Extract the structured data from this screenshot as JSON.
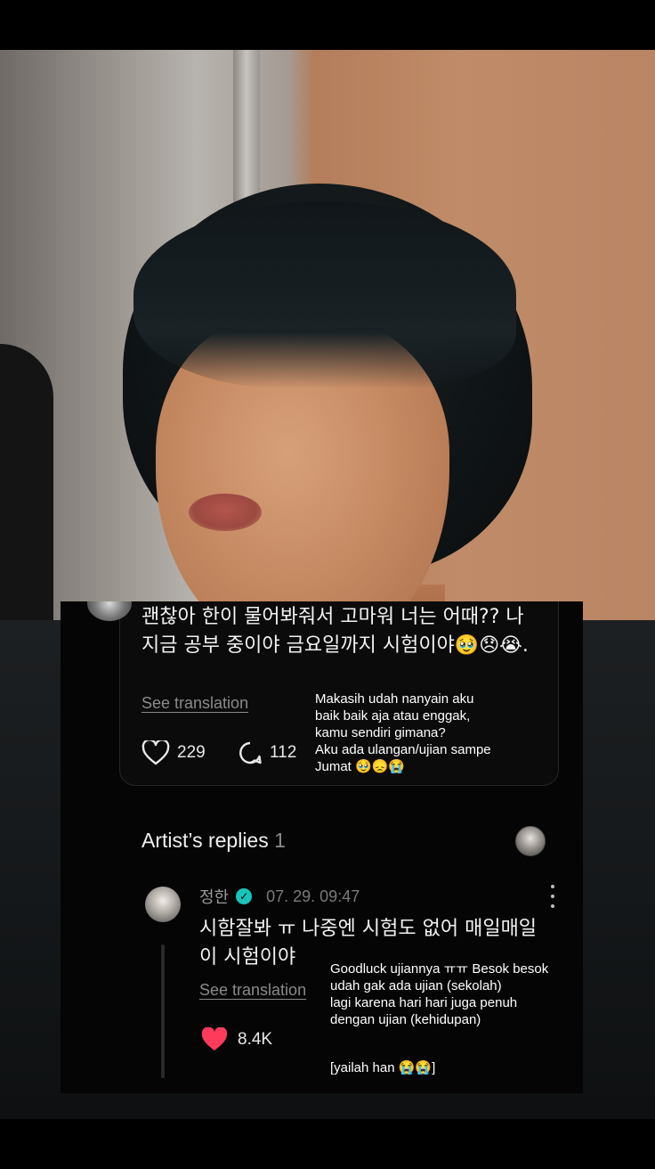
{
  "post": {
    "text": "괜찮아 한이 물어봐줘서 고마워 너는 어때?? 나 지금 공부 중이야 금요일까지 시험이야🥹😞😭.",
    "see_translation": "See translation",
    "likes": "229",
    "comments": "112",
    "caption_lines": [
      "Makasih udah nanyain aku",
      "baik baik aja atau enggak,",
      "kamu sendiri gimana?",
      "Aku ada ulangan/ujian sampe",
      "Jumat 🥹😞😭"
    ]
  },
  "artist_replies": {
    "title": "Artist’s replies",
    "count": "1"
  },
  "reply": {
    "name": "정한",
    "verified_mark": "✓",
    "date": "07. 29. 09:47",
    "text": "시함잘봐 ㅠ 나중엔 시험도 없어 매일매일 이 시험이야",
    "see_translation": "See translation",
    "likes": "8.4K",
    "caption_lines": [
      "Goodluck ujiannya ㅠㅠ Besok besok",
      "udah gak ada ujian (sekolah)",
      "lagi karena hari hari juga penuh",
      "dengan ujian (kehidupan)",
      "",
      "[yailah han 😭😭]"
    ]
  },
  "colors": {
    "panel_bg": "#050505",
    "verified": "#19c4b8",
    "heart": "#ff3b5c"
  }
}
